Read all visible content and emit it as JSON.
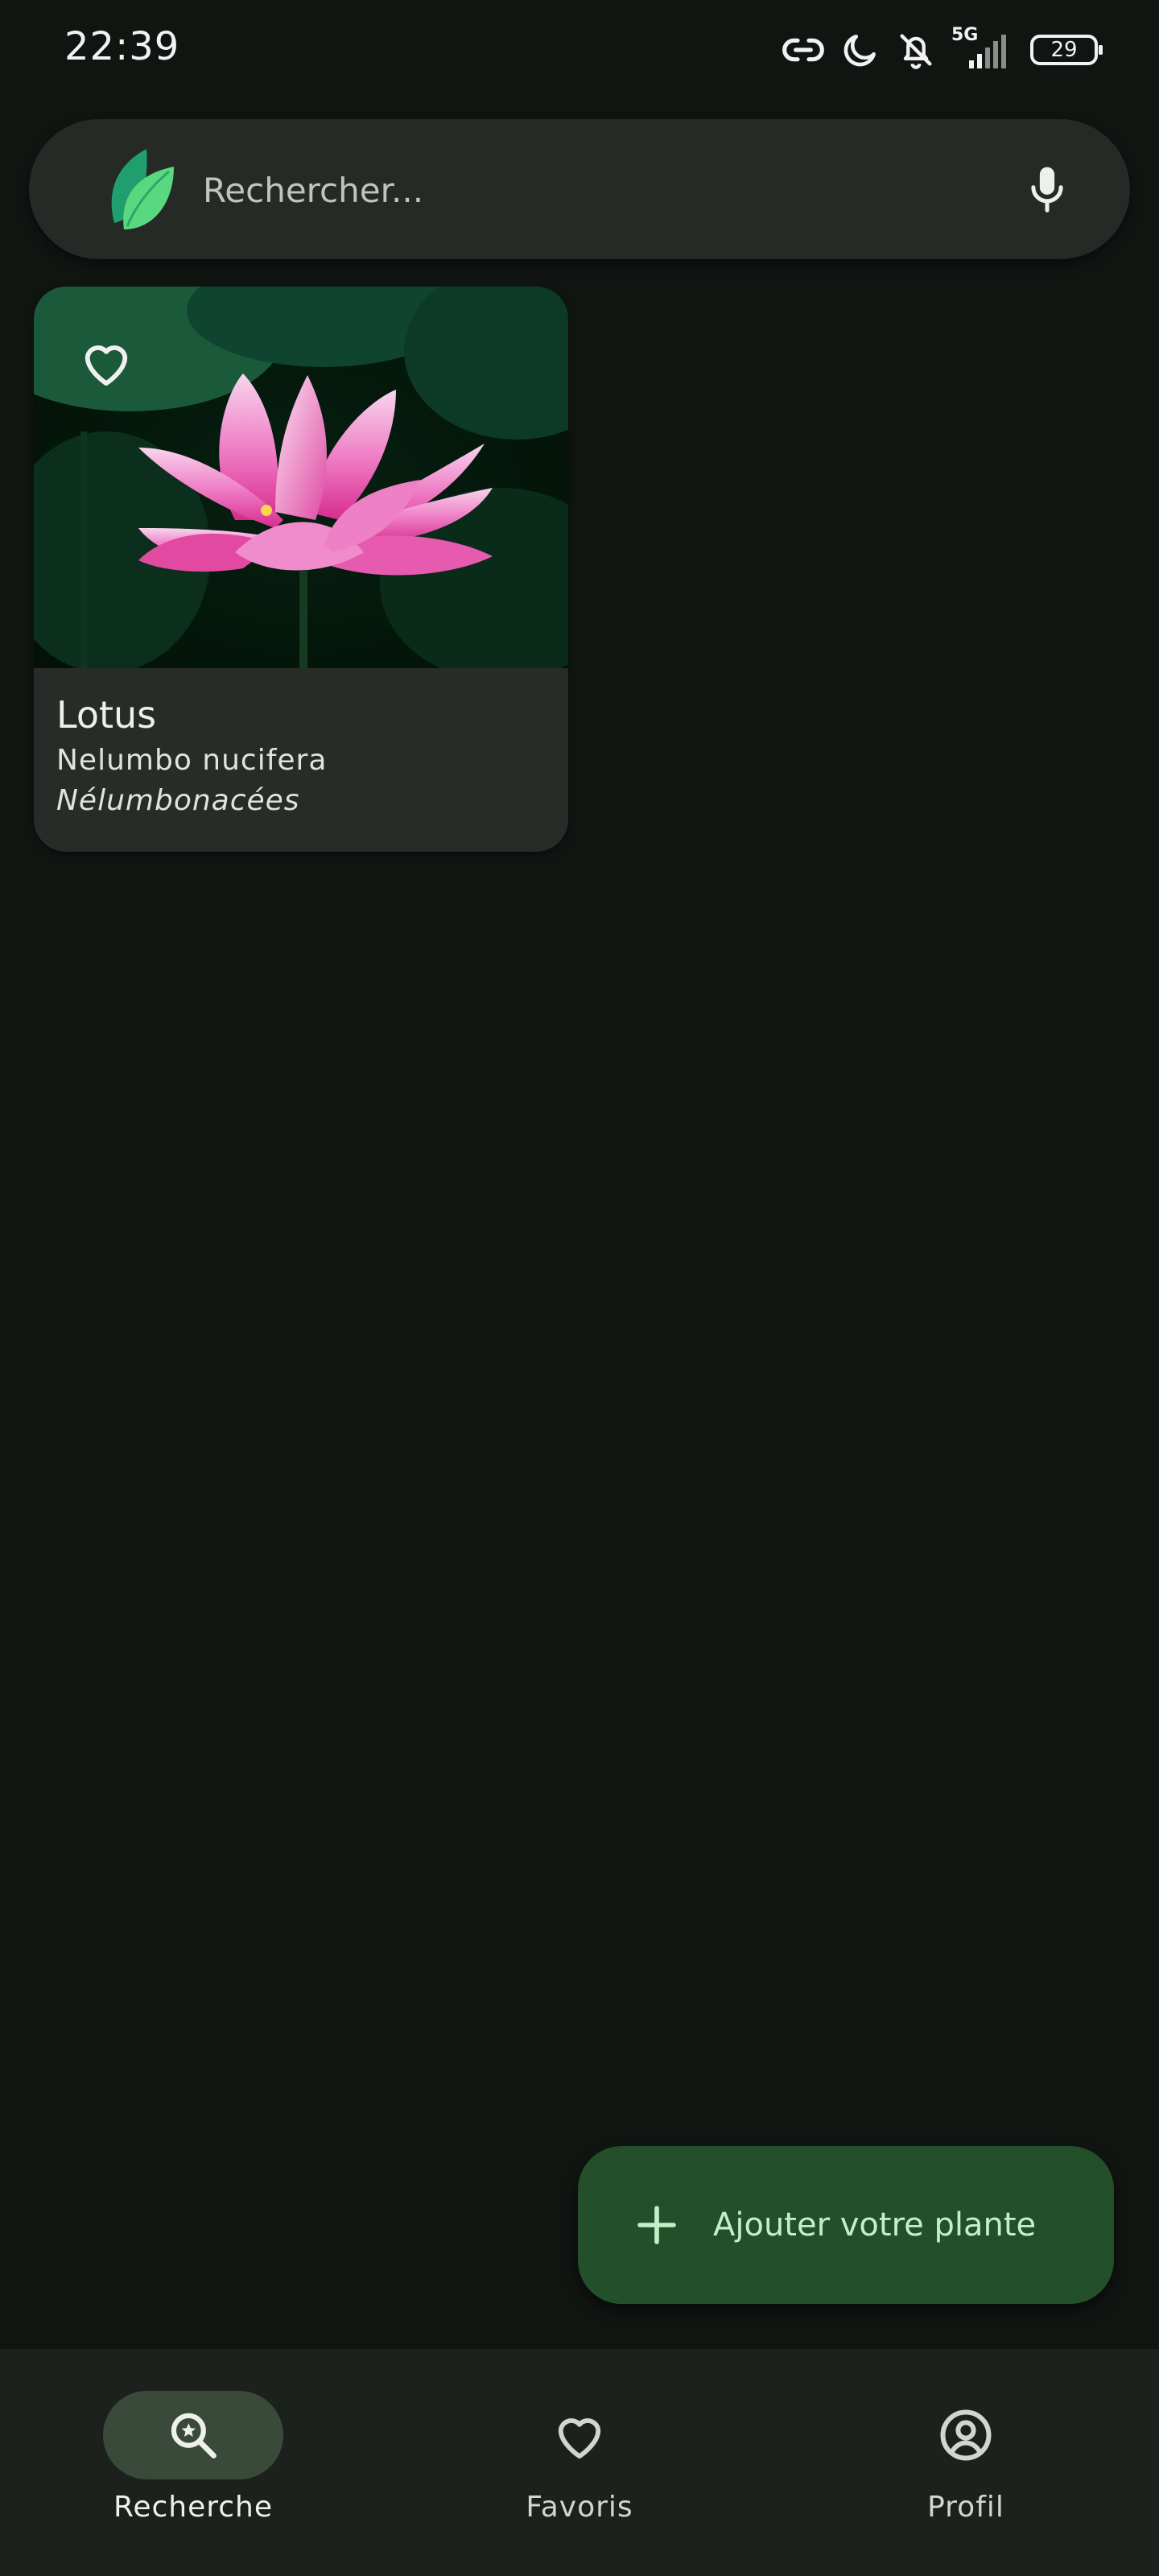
{
  "status_bar": {
    "time": "22:39",
    "network": "5G",
    "battery": "29",
    "icons": [
      "link-icon",
      "moon-icon",
      "bell-off-icon",
      "signal-icon",
      "battery-icon"
    ]
  },
  "search": {
    "placeholder": "Rechercher...",
    "icons": [
      "leaf-logo-icon",
      "microphone-icon"
    ]
  },
  "plants": [
    {
      "name": "Lotus",
      "scientific_name": "Nelumbo nucifera",
      "family": "Nélumbonacées",
      "image": "pink-lotus-flower",
      "favorite_icon": "heart-outline-icon"
    }
  ],
  "fab": {
    "label": "Ajouter votre plante",
    "icon": "plus-icon"
  },
  "bottom_nav": {
    "items": [
      {
        "label": "Recherche",
        "icon": "search-icon",
        "active": true
      },
      {
        "label": "Favoris",
        "icon": "heart-icon",
        "active": false
      },
      {
        "label": "Profil",
        "icon": "profile-icon",
        "active": false
      }
    ]
  },
  "colors": {
    "background": "#111512",
    "surface": "#252a26",
    "card": "#272c28",
    "fab": "#23502a",
    "fab_text": "#c6efc6",
    "nav_active_indicator": "#394a3b",
    "accent_leaf": "#2ecc71"
  }
}
